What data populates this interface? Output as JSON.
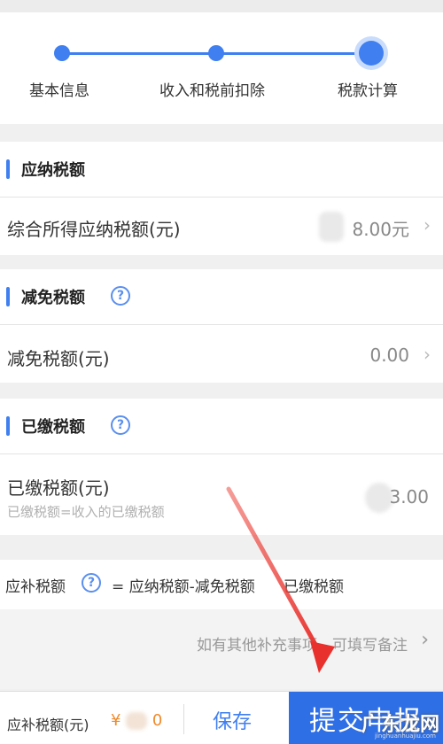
{
  "stepper": {
    "steps": [
      {
        "label": "基本信息"
      },
      {
        "label": "收入和税前扣除"
      },
      {
        "label": "税款计算"
      }
    ],
    "active_step": 3,
    "accent_color": "#3f7ff0"
  },
  "sections": {
    "taxable": {
      "title": "应纳税额",
      "row_label": "综合所得应纳税额(元)",
      "row_value": "8.00元"
    },
    "reduction": {
      "title": "减免税额",
      "help_icon": "?",
      "row_label": "减免税额(元)",
      "row_value": "0.00"
    },
    "paid": {
      "title": "已缴税额",
      "help_icon": "?",
      "row_label": "已缴税额(元)",
      "row_sub": "已缴税额=收入的已缴税额",
      "row_value": "3.00"
    }
  },
  "formula": {
    "label": "应补税额",
    "help_icon": "?",
    "text": "= 应纳税额-减免税额",
    "text2": "已缴税额"
  },
  "note": {
    "text": "如有其他补充事项，可填写备注"
  },
  "bottom_bar": {
    "label": "应补税额(元)",
    "currency": "¥",
    "amount_visible": "0",
    "save_label": "保存",
    "submit_label": "提交申报"
  },
  "watermark": {
    "text": "广东龙网",
    "sub": "jinghuanhuajiu.com"
  },
  "annotation": {
    "arrow_color": "#e8302c"
  }
}
